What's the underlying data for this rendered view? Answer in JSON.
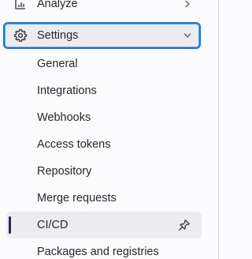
{
  "sidebar": {
    "analyze": {
      "label": "Analyze",
      "icon": "chart-icon",
      "expanded": false
    },
    "settings": {
      "label": "Settings",
      "icon": "gear-icon",
      "expanded": true,
      "items": [
        {
          "label": "General"
        },
        {
          "label": "Integrations"
        },
        {
          "label": "Webhooks"
        },
        {
          "label": "Access tokens"
        },
        {
          "label": "Repository"
        },
        {
          "label": "Merge requests"
        },
        {
          "label": "CI/CD",
          "active": true,
          "pin_icon": "thumbtack-icon"
        },
        {
          "label": "Packages and registries"
        }
      ]
    }
  },
  "colors": {
    "focus_border": "#1f75cb",
    "active_indicator": "#252466",
    "active_bg": "#ececef"
  }
}
